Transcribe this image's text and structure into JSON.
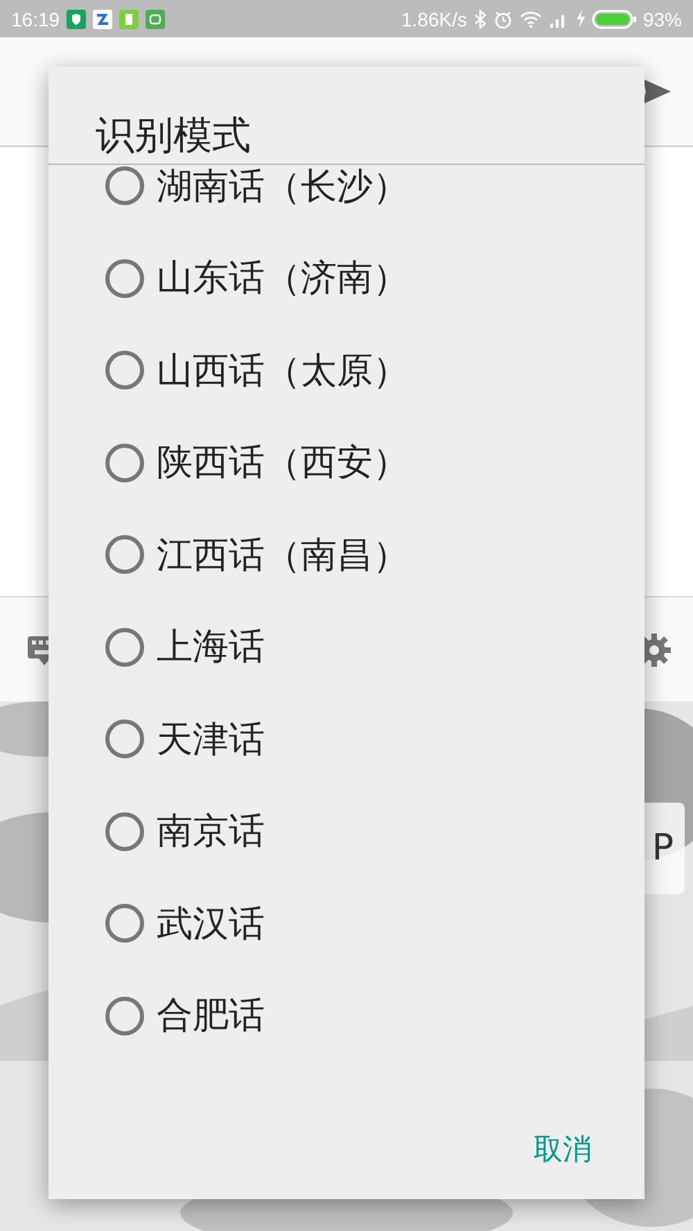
{
  "status_bar": {
    "time": "16:19",
    "speed": "1.86K/s",
    "battery": "93%"
  },
  "keyboard": {
    "visible_key": "P"
  },
  "dialog": {
    "title": "识别模式",
    "options": [
      {
        "label": "湖南话（长沙）",
        "selected": false
      },
      {
        "label": "山东话（济南）",
        "selected": false
      },
      {
        "label": "山西话（太原）",
        "selected": false
      },
      {
        "label": "陕西话（西安）",
        "selected": false
      },
      {
        "label": "江西话（南昌）",
        "selected": false
      },
      {
        "label": "上海话",
        "selected": false
      },
      {
        "label": "天津话",
        "selected": false
      },
      {
        "label": "南京话",
        "selected": false
      },
      {
        "label": "武汉话",
        "selected": false
      },
      {
        "label": "合肥话",
        "selected": false
      }
    ],
    "cancel": "取消"
  }
}
